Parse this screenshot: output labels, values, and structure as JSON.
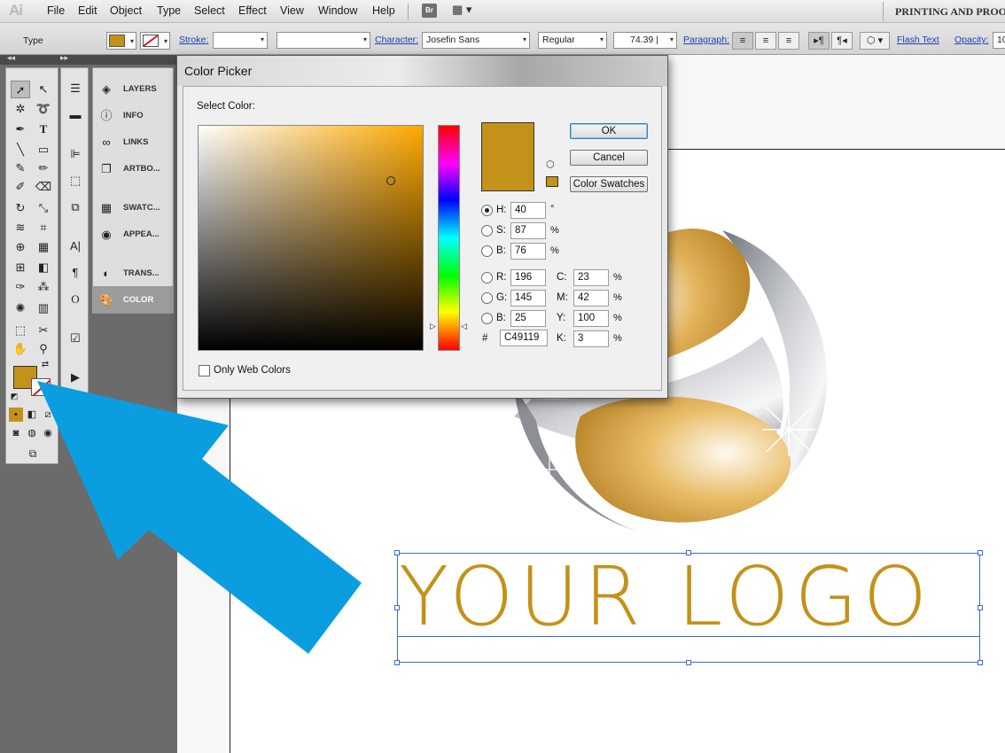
{
  "menubar": {
    "app_logo": "Ai",
    "items": [
      "File",
      "Edit",
      "Object",
      "Type",
      "Select",
      "Effect",
      "View",
      "Window",
      "Help"
    ],
    "bridge_label": "Br",
    "workspace": "PRINTING AND PROO"
  },
  "control_bar": {
    "selection_type": "Type",
    "fill_color": "#c49119",
    "stroke_label": "Stroke:",
    "character_label": "Character:",
    "font_family": "Josefin Sans",
    "font_style": "Regular",
    "font_size": "74.39 |",
    "paragraph_label": "Paragraph:",
    "flash_text_label": "Flash Text",
    "opacity_label": "Opacity:",
    "opacity_value": "10"
  },
  "panels": {
    "header_left": "◂◂",
    "header_mid": "▸▸",
    "items": [
      {
        "label": "LAYERS",
        "icon": "layers-icon"
      },
      {
        "label": "INFO",
        "icon": "info-icon"
      },
      {
        "label": "LINKS",
        "icon": "links-icon"
      },
      {
        "label": "ARTBO...",
        "icon": "artboards-icon"
      },
      {
        "label": "SWATC...",
        "icon": "swatches-icon"
      },
      {
        "label": "APPEA...",
        "icon": "appearance-icon"
      },
      {
        "label": "TRANS...",
        "icon": "transparency-icon"
      },
      {
        "label": "COLOR",
        "icon": "color-icon"
      }
    ]
  },
  "canvas": {
    "logo_text": "YOUR LOGO",
    "logo_color": "#c49119",
    "arrow_color": "#0a9ee0"
  },
  "color_picker": {
    "title": "Color Picker",
    "select_label": "Select Color:",
    "ok": "OK",
    "cancel": "Cancel",
    "swatches": "Color Swatches",
    "current_color": "#c49119",
    "h_label": "H:",
    "h": "40",
    "h_unit": "°",
    "s_label": "S:",
    "s": "87",
    "s_unit": "%",
    "b_label": "B:",
    "b": "76",
    "b_unit": "%",
    "r_label": "R:",
    "r": "196",
    "g_label": "G:",
    "g": "145",
    "bl_label": "B:",
    "bl": "25",
    "c_label": "C:",
    "c": "23",
    "c_unit": "%",
    "m_label": "M:",
    "m": "42",
    "m_unit": "%",
    "y_label": "Y:",
    "y": "100",
    "y_unit": "%",
    "k_label": "K:",
    "k": "3",
    "k_unit": "%",
    "hex_label": "#",
    "hex": "C49119",
    "web_colors_label": "Only Web Colors"
  }
}
